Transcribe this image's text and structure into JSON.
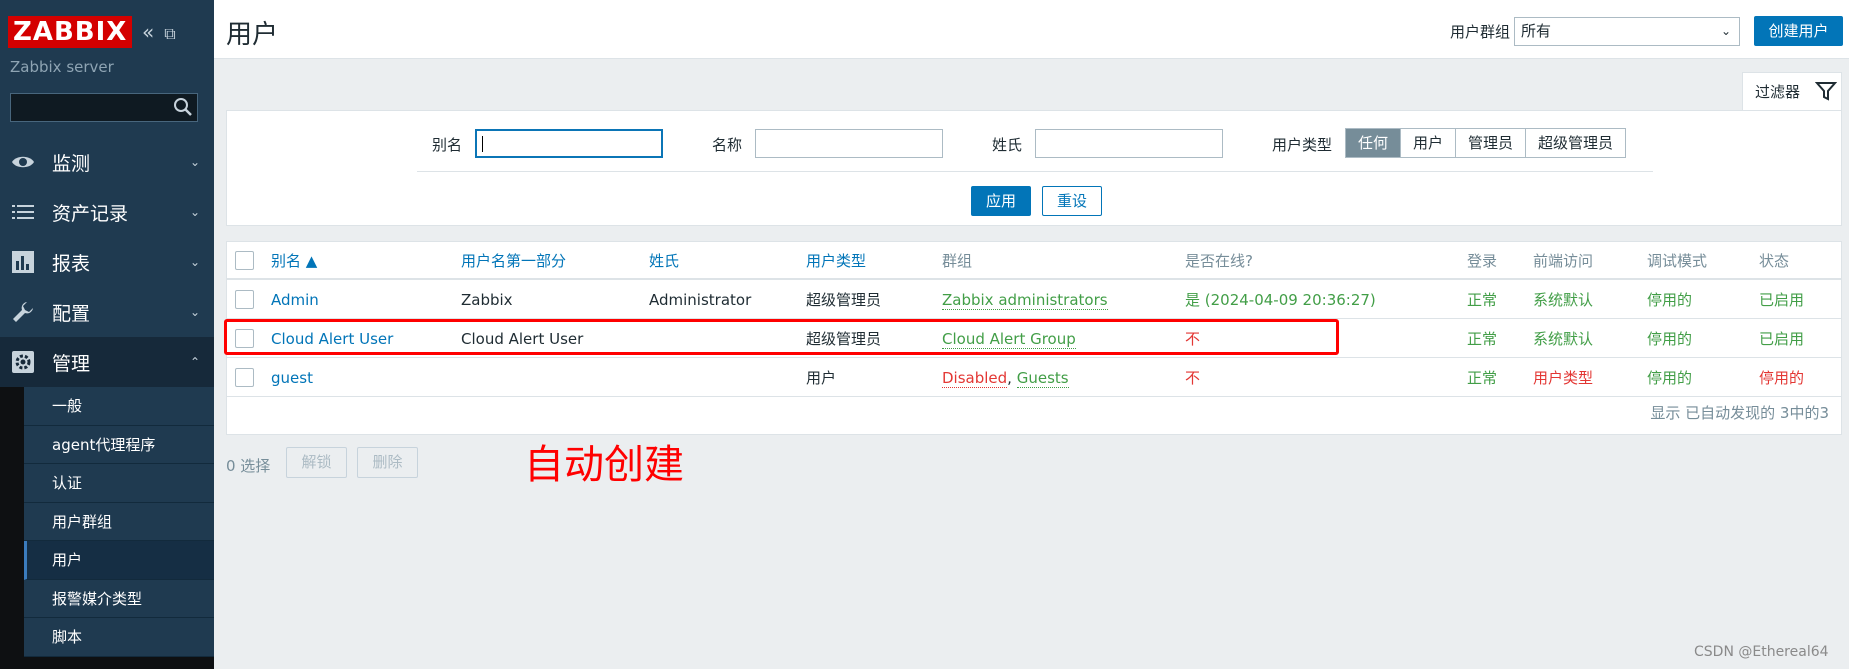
{
  "sidebar": {
    "logo": "ZABBIX",
    "server_name": "Zabbix server",
    "search_placeholder": "",
    "menu": [
      {
        "label": "监测"
      },
      {
        "label": "资产记录"
      },
      {
        "label": "报表"
      },
      {
        "label": "配置"
      },
      {
        "label": "管理"
      }
    ],
    "submenu": [
      "一般",
      "agent代理程序",
      "认证",
      "用户群组",
      "用户",
      "报警媒介类型",
      "脚本"
    ]
  },
  "header": {
    "title": "用户",
    "group_label": "用户群组",
    "group_value": "所有",
    "create_button": "创建用户"
  },
  "filter": {
    "tab_label": "过滤器",
    "alias_label": "别名",
    "name_label": "名称",
    "surname_label": "姓氏",
    "usertype_label": "用户类型",
    "usertype_options": [
      "任何",
      "用户",
      "管理员",
      "超级管理员"
    ],
    "apply": "应用",
    "reset": "重设"
  },
  "table": {
    "headers": {
      "alias": "别名 ▲",
      "name": "用户名第一部分",
      "surname": "姓氏",
      "type": "用户类型",
      "groups": "群组",
      "online": "是否在线?",
      "login": "登录",
      "frontend": "前端访问",
      "debug": "调试模式",
      "status": "状态"
    },
    "rows": [
      {
        "alias": "Admin",
        "name": "Zabbix",
        "surname": "Administrator",
        "type": "超级管理员",
        "groups": "Zabbix administrators",
        "online": "是 (2024-04-09 20:36:27)",
        "login": "正常",
        "frontend": "系统默认",
        "debug": "停用的",
        "status": "已启用"
      },
      {
        "alias": "Cloud Alert User",
        "name": "Cloud Alert User",
        "surname": "",
        "type": "超级管理员",
        "groups": "Cloud Alert Group",
        "online": "不",
        "login": "正常",
        "frontend": "系统默认",
        "debug": "停用的",
        "status": "已启用"
      },
      {
        "alias": "guest",
        "name": "",
        "surname": "",
        "type": "用户",
        "group_a": "Disabled",
        "group_sep": ", ",
        "group_b": "Guests",
        "online": "不",
        "login": "正常",
        "frontend": "用户类型",
        "debug": "停用的",
        "status": "停用的"
      }
    ],
    "footer": "显示 已自动发现的 3中的3"
  },
  "actions": {
    "selected": "0 选择",
    "unlock": "解锁",
    "delete": "删除"
  },
  "annotation": "自动创建",
  "watermark": "CSDN @Ethereal64",
  "colors": {
    "sidebar_bg": "#1f3a50",
    "accent": "#0275b8",
    "logo_red": "#d40000",
    "ok_green": "#429e47",
    "error_red": "#e33734",
    "highlight": "#ff0000"
  }
}
